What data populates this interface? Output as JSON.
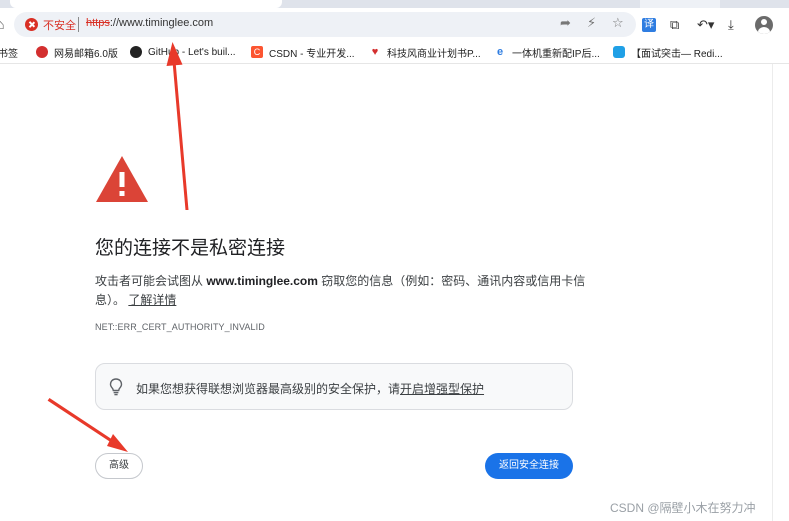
{
  "browser": {
    "omnibox": {
      "security_label": "不安全",
      "url_scheme": "https",
      "url_rest": "://www.timinglee.com"
    },
    "translate_label": "译",
    "bookmarks": [
      {
        "label": "书签",
        "icon": "bookmark-folder-icon"
      },
      {
        "label": "网易邮箱6.0版",
        "icon": "netease-mail-icon"
      },
      {
        "label": "GitHub - Let's buil...",
        "icon": "github-icon"
      },
      {
        "label": "CSDN - 专业开发...",
        "icon": "csdn-icon"
      },
      {
        "label": "科技风商业计划书P...",
        "icon": "heart-logo-icon"
      },
      {
        "label": "一体机重新配IP后...",
        "icon": "ie-logo-icon"
      },
      {
        "label": "【面试突击— Redi...",
        "icon": "bilibili-icon"
      }
    ]
  },
  "error_page": {
    "title": "您的连接不是私密连接",
    "desc_prefix": "攻击者可能会试图从 ",
    "desc_domain": "www.timinglee.com",
    "desc_suffix": " 窃取您的信息（例如：密码、通讯内容或信用卡信息）。",
    "learn_more": "了解详情",
    "error_code": "NET::ERR_CERT_AUTHORITY_INVALID",
    "protection_text": "如果您想获得联想浏览器最高级别的安全保护，请",
    "protection_link": "开启增强型保护",
    "advanced_button": "高级",
    "back_button": "返回安全连接"
  },
  "watermark": "CSDN @隔壁小木在努力冲",
  "colors": {
    "accent_blue": "#1a73e8",
    "warning_red": "#d93025",
    "annotation_arrow": "#e8392a"
  }
}
